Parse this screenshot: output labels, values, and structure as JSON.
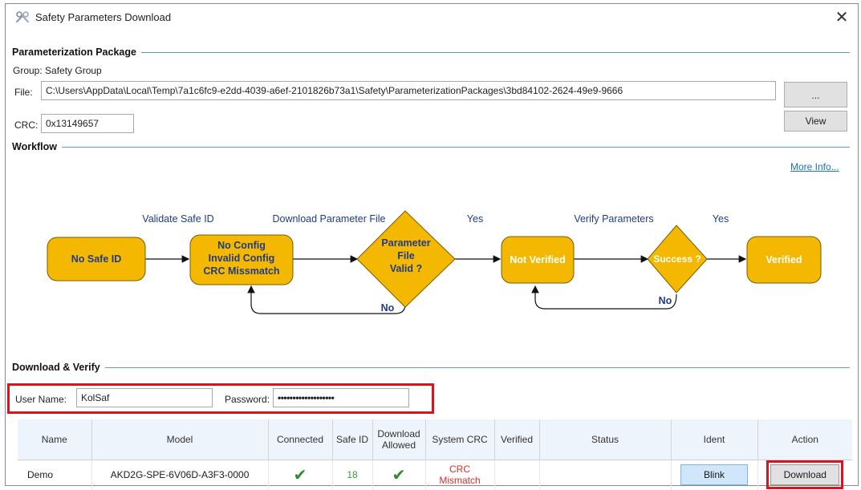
{
  "window": {
    "title": "Safety Parameters Download",
    "close_glyph": "✕"
  },
  "package": {
    "section_title": "Parameterization Package",
    "group": "Group: Safety Group",
    "file_label": "File:",
    "file_value": "C:\\Users\\AppData\\Local\\Temp\\7a1c6fc9-e2dd-4039-a6ef-2101826b73a1\\Safety\\ParameterizationPackages\\3bd84102-2624-49e9-9666",
    "browse_label": "...",
    "crc_label": "CRC:",
    "crc_value": "0x13149657",
    "view_label": "View"
  },
  "workflow": {
    "section_title": "Workflow",
    "more_info": "More Info...",
    "nodes": {
      "no_safe_id": "No Safe ID",
      "no_config_1": "No Config",
      "no_config_2": "Invalid Config",
      "no_config_3": "CRC Missmatch",
      "param_1": "Parameter",
      "param_2": "File",
      "param_3": "Valid ?",
      "not_verified": "Not Verified",
      "success": "Success ?",
      "verified": "Verified"
    },
    "edges": {
      "validate": "Validate Safe ID",
      "download": "Download Parameter File",
      "yes1": "Yes",
      "verify": "Verify Parameters",
      "yes2": "Yes",
      "no1": "No",
      "no2": "No"
    },
    "colors": {
      "node_fill": "#f5b800",
      "node_stroke": "#7a5c00",
      "label_blue": "#1f3c88"
    }
  },
  "download": {
    "section_title": "Download & Verify",
    "username_label": "User Name:",
    "username_value": "KolSaf",
    "password_label": "Password:",
    "password_value": "•••••••••••••••••••"
  },
  "table": {
    "headers": {
      "name": "Name",
      "model": "Model",
      "connected": "Connected",
      "safe_id": "Safe ID",
      "download_allowed": "Download Allowed",
      "system_crc": "System CRC",
      "verified": "Verified",
      "status": "Status",
      "ident": "Ident",
      "action": "Action"
    },
    "row": {
      "name": "Demo",
      "model": "AKD2G-SPE-6V06D-A3F3-0000",
      "connected_glyph": "✔",
      "safe_id": "18",
      "download_allowed_glyph": "✔",
      "system_crc": "CRC Mismatch",
      "verified": "",
      "status": "",
      "ident_button": "Blink",
      "action_button": "Download"
    }
  }
}
